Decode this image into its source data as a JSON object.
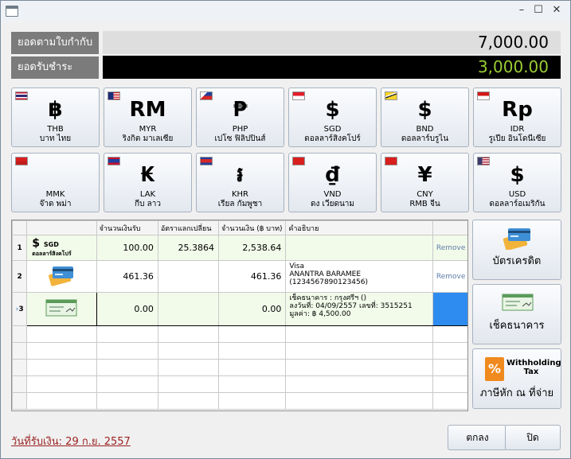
{
  "window": {
    "minimize": "–",
    "maximize": "☐",
    "close": "✕"
  },
  "summary": {
    "invoice_label": "ยอดตามใบกำกับ",
    "invoice_amount": "7,000.00",
    "received_label": "ยอดรับชำระ",
    "received_amount": "3,000.00",
    "received_color": "#9acd32"
  },
  "currencies": [
    {
      "symbol": "฿",
      "code": "THB",
      "name": "บาท ไทย",
      "flag": "thailand"
    },
    {
      "symbol": "RM",
      "code": "MYR",
      "name": "ริงกิต มาเลเซีย",
      "flag": "malaysia"
    },
    {
      "symbol": "₱",
      "code": "PHP",
      "name": "เปโซ ฟิลิปปินส์",
      "flag": "philippines"
    },
    {
      "symbol": "$",
      "code": "SGD",
      "name": "ดอลลาร์สิงคโปร์",
      "flag": "singapore"
    },
    {
      "symbol": "$",
      "code": "BND",
      "name": "ดอลลาร์บรูไน",
      "flag": "brunei"
    },
    {
      "symbol": "Rp",
      "code": "IDR",
      "name": "รูเปีย อินโดนีเซีย",
      "flag": "indonesia"
    },
    {
      "symbol": "",
      "code": "MMK",
      "name": "จ๊าด พม่า",
      "flag": "myanmar"
    },
    {
      "symbol": "₭",
      "code": "LAK",
      "name": "กีบ ลาว",
      "flag": "laos"
    },
    {
      "symbol": "៛",
      "code": "KHR",
      "name": "เรียล กัมพูชา",
      "flag": "cambodia"
    },
    {
      "symbol": "₫",
      "code": "VND",
      "name": "ดง เวียดนาม",
      "flag": "vietnam"
    },
    {
      "symbol": "¥",
      "code": "CNY",
      "name": "RMB จีน",
      "flag": "china"
    },
    {
      "symbol": "$",
      "code": "USD",
      "name": "ดอลลาร์อเมริกัน",
      "flag": "usa"
    }
  ],
  "grid": {
    "headers": [
      "",
      "",
      "จำนวนเงินรับ",
      "อัตราแลกเปลี่ยน",
      "จำนวนเงิน (฿ บาท)",
      "คำอธิบาย",
      ""
    ],
    "rows": [
      {
        "num": "1",
        "icon": "$",
        "icon_code": "SGD",
        "icon_name": "ดอลลาร์สิงคโปร์",
        "received": "100.00",
        "rate": "25.3864",
        "amount": "2,538.64",
        "desc1": "",
        "desc2": "",
        "desc3": "",
        "action": "Remove"
      },
      {
        "num": "2",
        "icon": "credit-card-icon",
        "received": "461.36",
        "rate": "",
        "amount": "461.36",
        "desc1": "Visa",
        "desc2": "ANANTRA BARAMEE",
        "desc3": "(1234567890123456)",
        "action": "Remove"
      },
      {
        "num": "3",
        "icon": "cheque-icon",
        "received": "0.00",
        "rate": "",
        "amount": "0.00",
        "desc1": "เช็คธนาคาร : กรุงศรีฯ ()",
        "desc2": "ลงวันที่: 04/09/2557  เลขที่: 3515251",
        "desc3": "มูลค่า: ฿ 4,500.00",
        "action": ""
      }
    ]
  },
  "side": {
    "credit_card": "บัตรเครดิต",
    "cheque": "เช็คธนาคาร",
    "withholding_word1": "Withholding",
    "withholding_word2": "Tax",
    "withholding_label": "ภาษีหัก ณ ที่จ่าย"
  },
  "footer": {
    "date_link": "วันที่รับเงิน: 29 ก.ย. 2557",
    "ok": "ตกลง",
    "close": "ปิด"
  }
}
